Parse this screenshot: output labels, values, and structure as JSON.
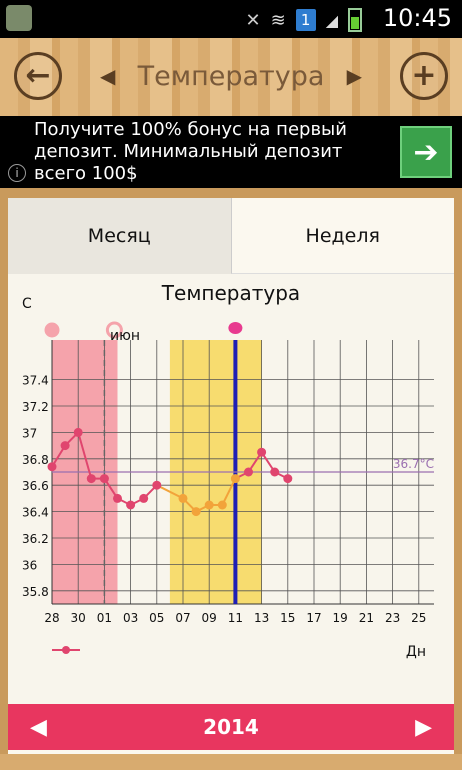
{
  "status_bar": {
    "time": "10:45",
    "notification_count": "1"
  },
  "header": {
    "title": "Температура",
    "prev_arrow": "◀",
    "next_arrow": "▶"
  },
  "ad": {
    "text": "Получите 100% бонус на первый депозит. Минимальный депозит всего 100$",
    "info": "i"
  },
  "tabs": [
    {
      "label": "Месяц"
    },
    {
      "label": "Неделя"
    }
  ],
  "footer": {
    "year": "2014",
    "prev": "◀",
    "next": "▶"
  },
  "colors": {
    "accent": "#e8365f",
    "line": "#e0456e",
    "fertile": "#f7dc6f",
    "period": "#f5a3ab",
    "ovulation": "#1f1fb5",
    "cover": "#9b6fb0"
  },
  "chart_data": {
    "type": "line",
    "title": "Температура",
    "ylabel": "C",
    "xlabel": "Дн",
    "month_label": "июн",
    "cover_line_label": "36.7°C",
    "cover_line_value": 36.7,
    "ylim": [
      35.7,
      37.7
    ],
    "y_ticks": [
      "35.8",
      "36",
      "36.2",
      "36.4",
      "36.6",
      "36.8",
      "37",
      "37.2",
      "37.4"
    ],
    "x_ticks": [
      "28",
      "30",
      "01",
      "03",
      "05",
      "07",
      "09",
      "11",
      "13",
      "15",
      "17",
      "19",
      "21",
      "23",
      "25"
    ],
    "days": [
      "28",
      "29",
      "30",
      "31",
      "01",
      "02",
      "03",
      "04",
      "05",
      "06",
      "07",
      "08",
      "09",
      "10",
      "11",
      "12",
      "13",
      "14",
      "15",
      "16",
      "17",
      "18",
      "19",
      "20",
      "21",
      "22",
      "23",
      "24",
      "25",
      "26"
    ],
    "series": [
      {
        "values": [
          36.74,
          36.9,
          37.0,
          36.65,
          36.65,
          36.5,
          36.45,
          36.5,
          36.6,
          null,
          36.5,
          36.4,
          36.45,
          36.45,
          36.65,
          36.7,
          36.85,
          36.7,
          36.65
        ]
      }
    ],
    "period_days": [
      "28",
      "01"
    ],
    "fertile_days": [
      "06",
      "12"
    ],
    "ovulation_day": "11",
    "grid": true
  }
}
